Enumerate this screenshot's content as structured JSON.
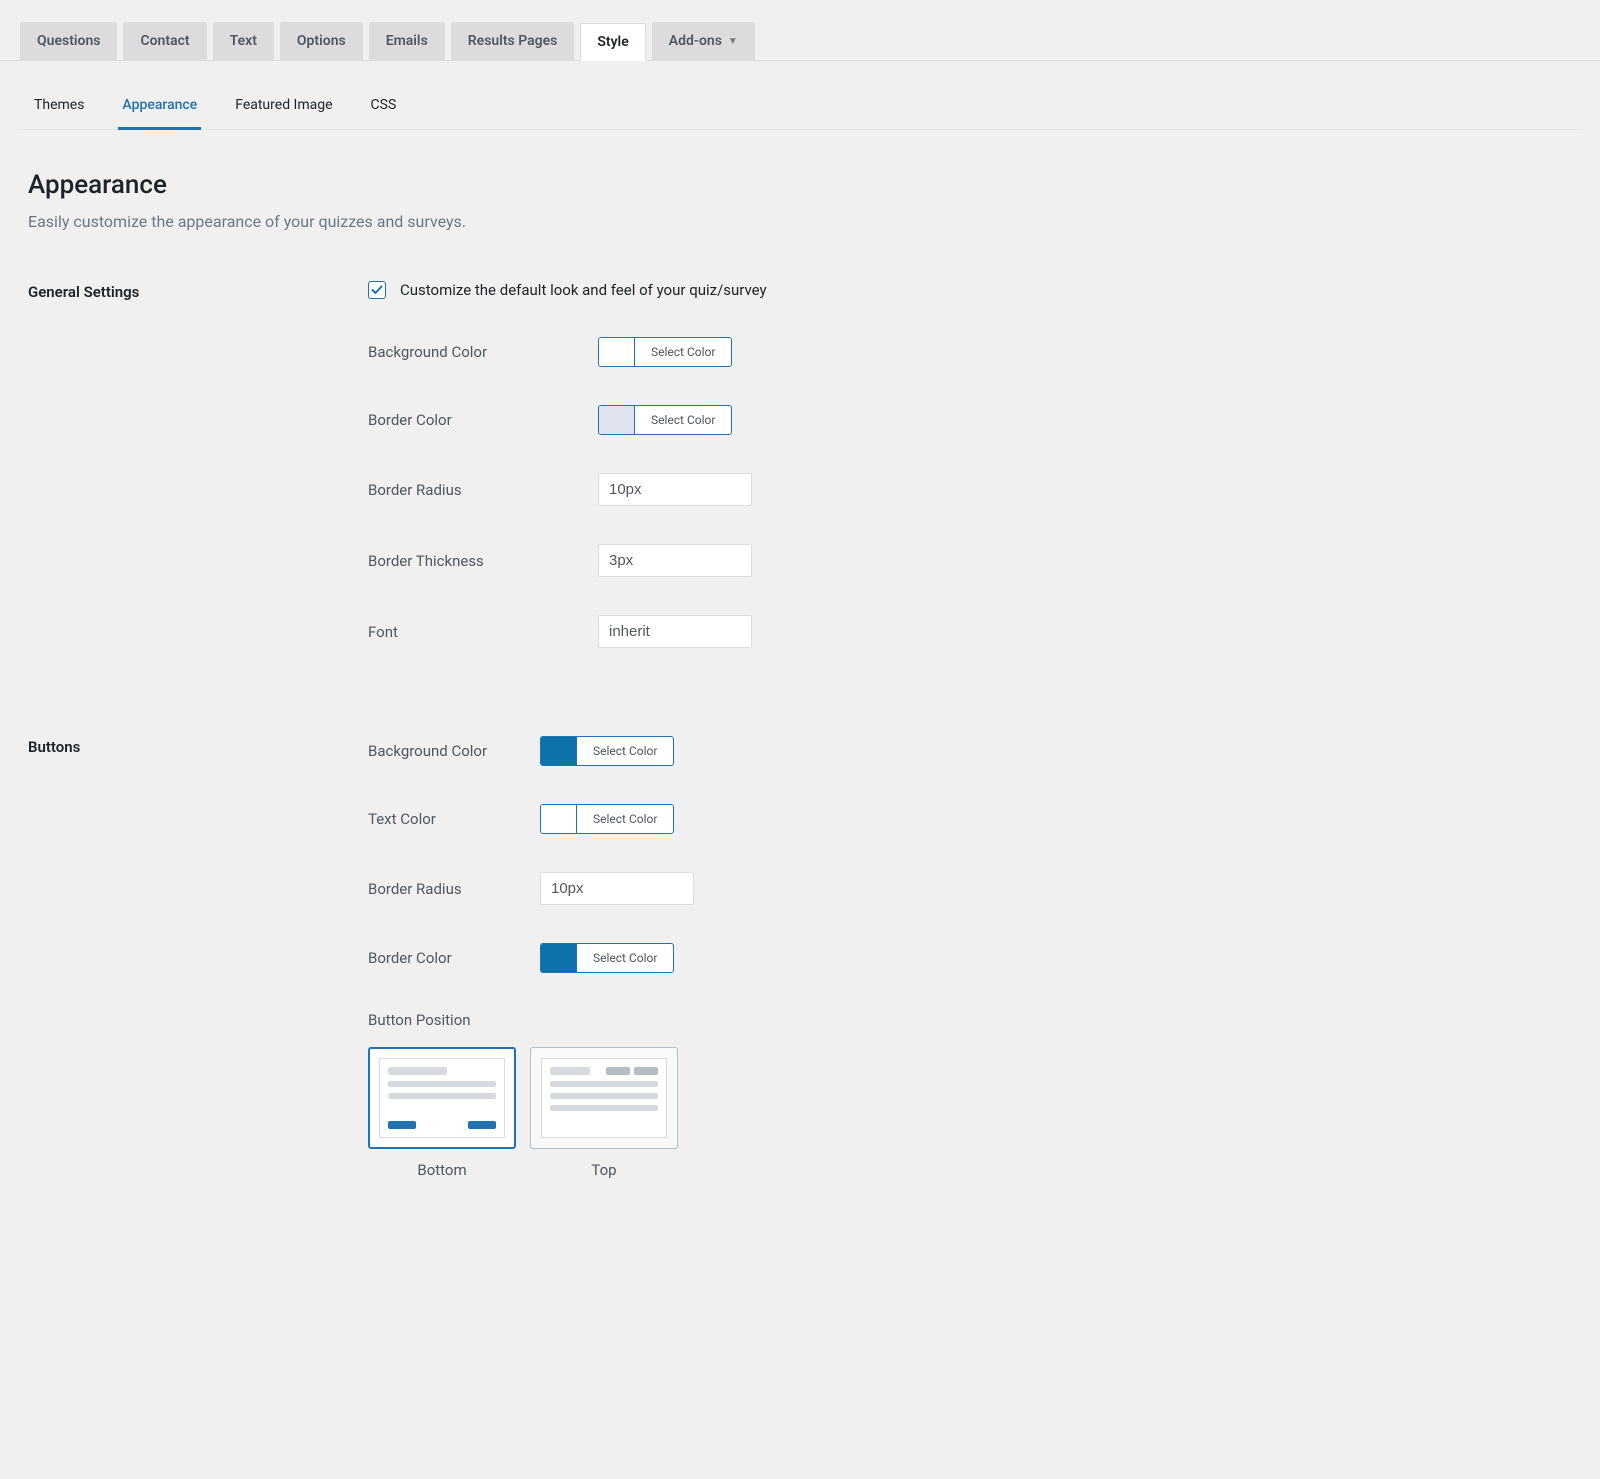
{
  "primaryTabs": {
    "questions": "Questions",
    "contact": "Contact",
    "text": "Text",
    "options": "Options",
    "emails": "Emails",
    "resultsPages": "Results Pages",
    "style": "Style",
    "addons": "Add-ons"
  },
  "subTabs": {
    "themes": "Themes",
    "appearance": "Appearance",
    "featuredImage": "Featured Image",
    "css": "CSS"
  },
  "page": {
    "title": "Appearance",
    "subtitle": "Easily customize the appearance of your quizzes and surveys."
  },
  "sections": {
    "general": {
      "heading": "General Settings",
      "customizeLabel": "Customize the default look and feel of your quiz/survey",
      "fields": {
        "backgroundColor": {
          "label": "Background Color",
          "color": "#ffffff",
          "button": "Select Color"
        },
        "borderColor": {
          "label": "Border Color",
          "color": "#dfe3f0",
          "button": "Select Color"
        },
        "borderRadius": {
          "label": "Border Radius",
          "value": "10px"
        },
        "borderThickness": {
          "label": "Border Thickness",
          "value": "3px"
        },
        "font": {
          "label": "Font",
          "value": "inherit"
        }
      }
    },
    "buttons": {
      "heading": "Buttons",
      "fields": {
        "backgroundColor": {
          "label": "Background Color",
          "color": "#0d72aa",
          "button": "Select Color"
        },
        "textColor": {
          "label": "Text Color",
          "color": "#ffffff",
          "button": "Select Color"
        },
        "borderRadius": {
          "label": "Border Radius",
          "value": "10px"
        },
        "borderColor": {
          "label": "Border Color",
          "color": "#0d72aa",
          "button": "Select Color"
        },
        "position": {
          "label": "Button Position",
          "options": {
            "bottom": "Bottom",
            "top": "Top"
          }
        }
      }
    }
  }
}
